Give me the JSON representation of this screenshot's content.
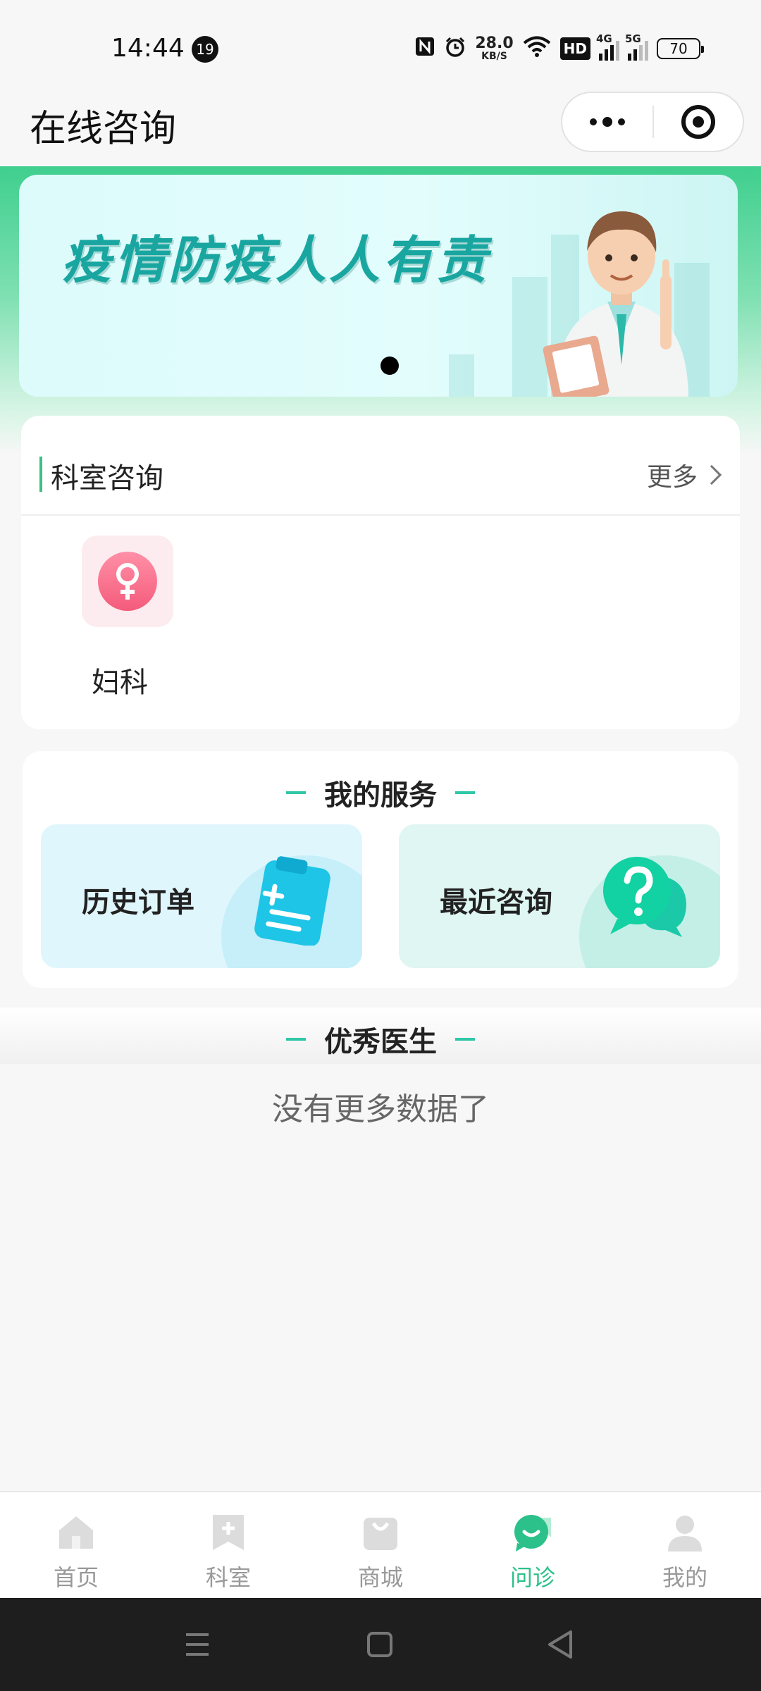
{
  "status_bar": {
    "time": "14:44",
    "notification_count": "19",
    "net_speed_value": "28.0",
    "net_speed_unit": "KB/S",
    "hd_label": "HD",
    "signal1_label": "4G",
    "signal2_label": "5G",
    "battery": "70"
  },
  "header": {
    "title": "在线咨询"
  },
  "banner": {
    "text": "疫情防疫人人有责",
    "page_indicator_active": 1,
    "page_count": 1
  },
  "department_section": {
    "title": "科室咨询",
    "more_label": "更多",
    "items": [
      {
        "name": "妇科",
        "icon": "female-symbol-icon"
      }
    ]
  },
  "service_section": {
    "title": "我的服务",
    "tiles": [
      {
        "label": "历史订单",
        "icon": "clipboard-icon"
      },
      {
        "label": "最近咨询",
        "icon": "question-chat-icon"
      }
    ]
  },
  "doctor_section": {
    "title": "优秀医生",
    "empty_text": "没有更多数据了"
  },
  "tab_bar": {
    "active_index": 3,
    "accent_color": "#2cc08a",
    "tabs": [
      {
        "label": "首页",
        "icon": "home-icon"
      },
      {
        "label": "科室",
        "icon": "department-icon"
      },
      {
        "label": "商城",
        "icon": "shop-bag-icon"
      },
      {
        "label": "问诊",
        "icon": "consult-chat-icon"
      },
      {
        "label": "我的",
        "icon": "user-icon"
      }
    ]
  },
  "colors": {
    "brand_green": "#3fcf8e",
    "section_accent": "#2fc7a8",
    "banner_text": "#19a6a0"
  }
}
